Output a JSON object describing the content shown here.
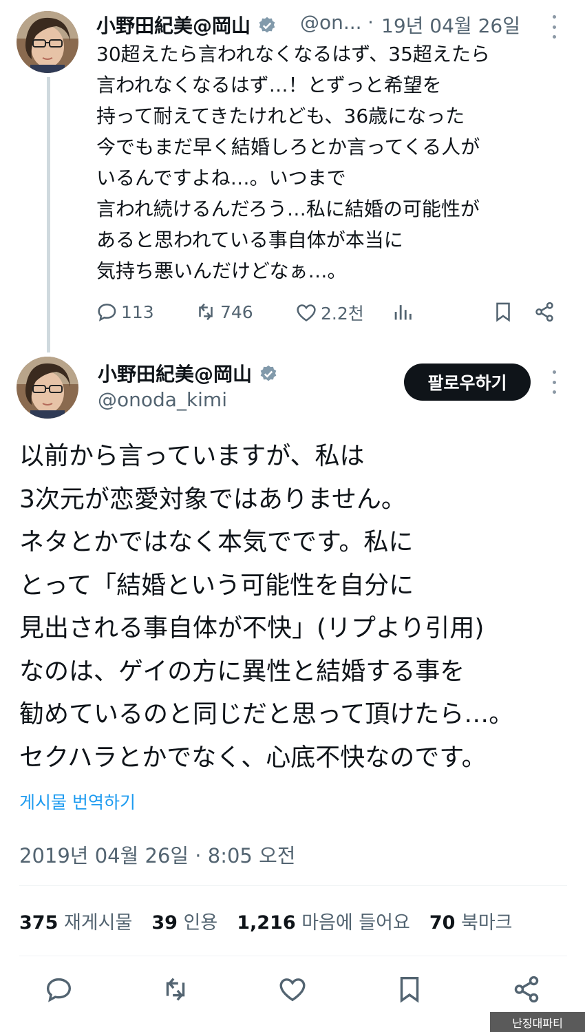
{
  "tweet1": {
    "display_name": "小野田紀美@岡山",
    "handle": "@on...",
    "separator": "·",
    "date": "19년 04월 26일",
    "lines": [
      "30超えたら言われなくなるはず、35超えたら",
      "言われなくなるはず…！とずっと希望を",
      "持って耐えてきたけれども、36歳になった",
      "今でもまだ早く結婚しろとか言ってくる人が",
      "いるんですよね…。いつまで",
      "言われ続けるんだろう…私に結婚の可能性が",
      "あると思われている事自体が本当に",
      "気持ち悪いんだけどなぁ…。"
    ],
    "replies": "113",
    "reposts": "746",
    "likes": "2.2천"
  },
  "tweet2": {
    "display_name": "小野田紀美@岡山",
    "handle": "@onoda_kimi",
    "follow_label": "팔로우하기",
    "lines": [
      "以前から言っていますが、私は",
      "3次元が恋愛対象ではありません。",
      "ネタとかではなく本気でです。私に",
      "とって「結婚という可能性を自分に",
      "見出される事自体が不快」(リプより引用)",
      "なのは、ゲイの方に異性と結婚する事を",
      "勧めているのと同じだと思って頂けたら…。",
      "セクハラとかでなく、心底不快なのです。"
    ],
    "translate_label": "게시물 번역하기",
    "timestamp": "2019년 04월 26일 · 8:05 오전",
    "stats": [
      {
        "value": "375",
        "label": "재게시물"
      },
      {
        "value": "39",
        "label": "인용"
      },
      {
        "value": "1,216",
        "label": "마음에 들어요"
      },
      {
        "value": "70",
        "label": "북마크"
      }
    ]
  },
  "watermark": "난징대파티",
  "colors": {
    "text": "#0f1419",
    "secondary": "#536471",
    "link": "#1d9bf0",
    "verified": "#829aab",
    "thread_line": "#cfd9de"
  },
  "icons": [
    "comment-icon",
    "repost-icon",
    "heart-icon",
    "views-icon",
    "bookmark-icon",
    "share-icon",
    "verified-badge-icon",
    "more-icon"
  ]
}
